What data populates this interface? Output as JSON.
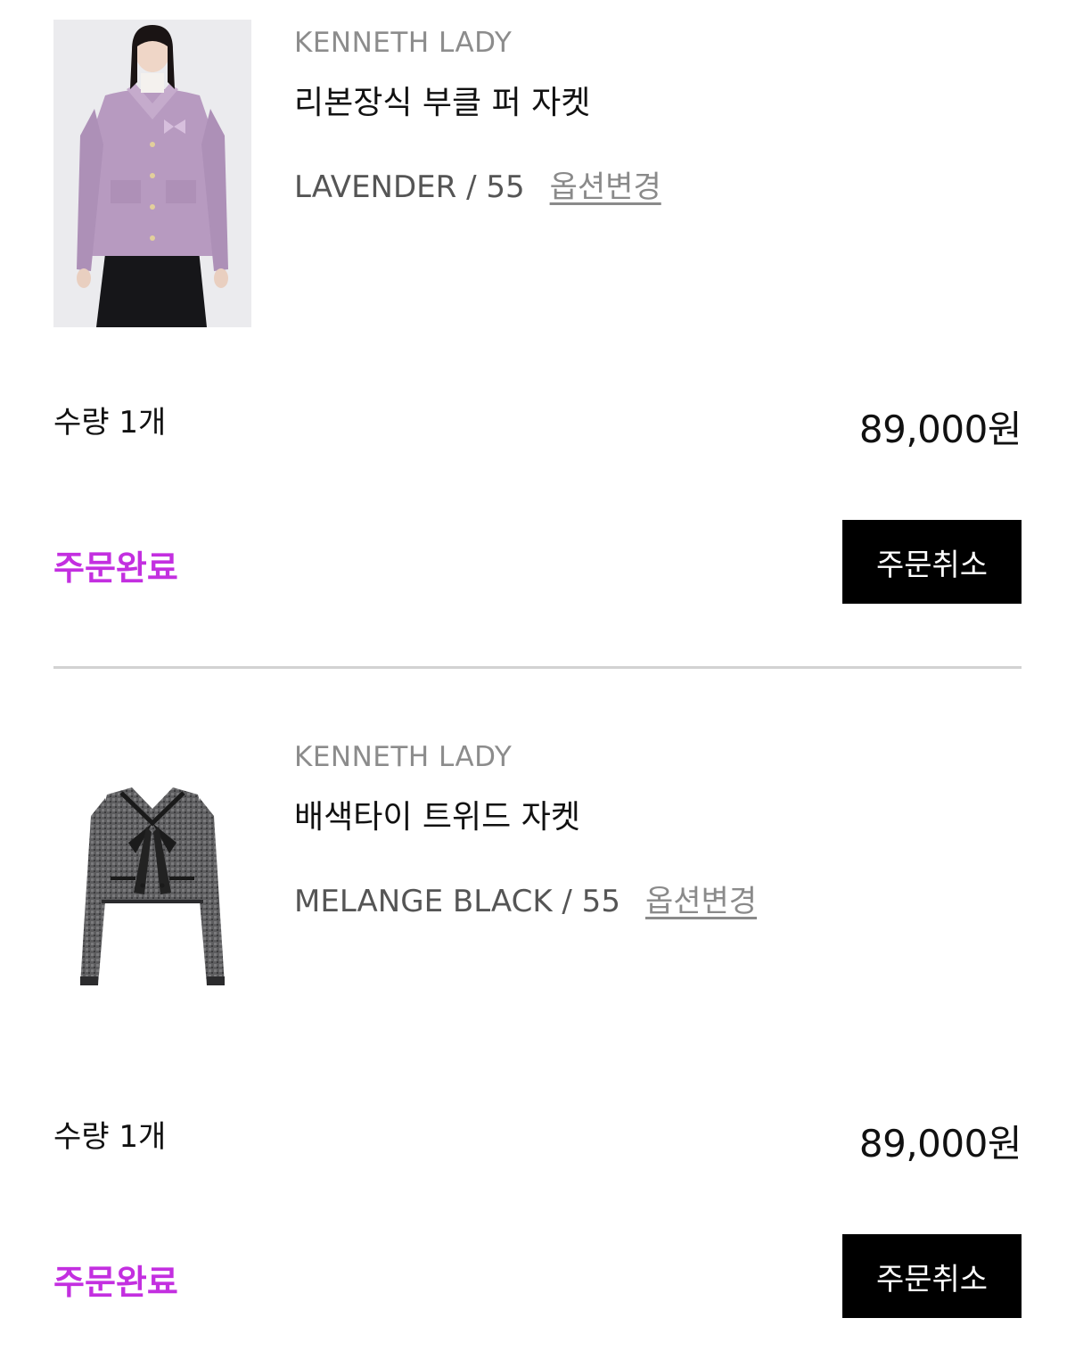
{
  "orders": [
    {
      "brand": "KENNETH LADY",
      "product_name": "리본장식 부클 퍼 자켓",
      "option": "LAVENDER / 55",
      "option_change_label": "옵션변경",
      "quantity": "수량 1개",
      "price": "89,000원",
      "status": "주문완료",
      "cancel_label": "주문취소"
    },
    {
      "brand": "KENNETH LADY",
      "product_name": "배색타이 트위드 자켓",
      "option": "MELANGE BLACK / 55",
      "option_change_label": "옵션변경",
      "quantity": "수량 1개",
      "price": "89,000원",
      "status": "주문완료",
      "cancel_label": "주문취소"
    }
  ],
  "colors": {
    "status": "#c32fe0",
    "button_bg": "#000000",
    "button_text": "#ffffff",
    "divider": "#d2d2d2",
    "brand_text": "#8c8c8c"
  }
}
